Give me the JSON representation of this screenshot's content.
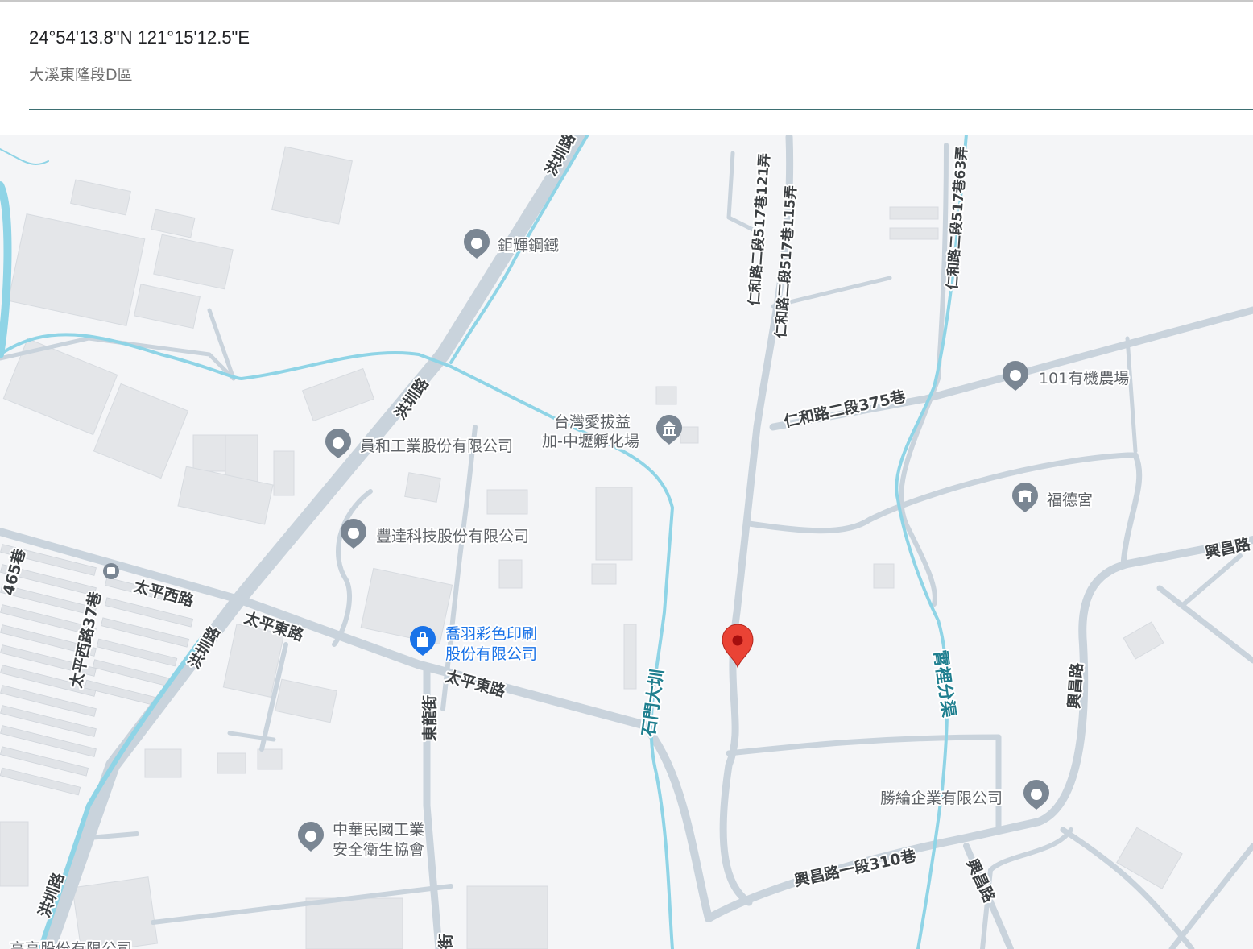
{
  "location": {
    "coordinates": "24°54'13.8\"N 121°15'12.5\"E",
    "name_value": "大溪東隆段D區"
  },
  "colors": {
    "map_bg": "#f4f5f7",
    "road": "#c9d3dc",
    "water": "#8fd4e6",
    "building": "#e4e6e9",
    "poi_gray": "#7a8693",
    "poi_blue": "#1a73e8",
    "pin_red": "#ea4335",
    "road_label": "#3c4043",
    "water_label": "#1f7f8f"
  },
  "map": {
    "pois": [
      {
        "name": "鉅輝鋼鐵",
        "kind": "pin",
        "icon": "pin-icon"
      },
      {
        "name": "員和工業股份有限公司",
        "kind": "pin",
        "icon": "pin-icon"
      },
      {
        "name": "豐達科技股份有限公司",
        "kind": "pin",
        "icon": "pin-icon"
      },
      {
        "name": "台灣愛拔益",
        "name2": "加-中壢孵化場",
        "kind": "government",
        "icon": "building-icon"
      },
      {
        "name": "101有機農場",
        "kind": "pin",
        "icon": "pin-icon"
      },
      {
        "name": "福德宮",
        "kind": "temple",
        "icon": "temple-icon"
      },
      {
        "name": "喬羽彩色印刷",
        "name2": "股份有限公司",
        "kind": "shopping",
        "icon": "shopping-bag-icon"
      },
      {
        "name": "勝綸企業有限公司",
        "kind": "pin",
        "icon": "pin-icon"
      },
      {
        "name": "中華民國工業",
        "name2": "安全衛生協會",
        "kind": "pin",
        "icon": "pin-icon"
      },
      {
        "name": "高亨股份有限公司",
        "kind": "pin",
        "icon": "pin-icon"
      }
    ],
    "road_labels": {
      "hongzhen_1": "洪圳路",
      "hongzhen_2": "洪圳路",
      "hongzhen_3": "洪圳路",
      "hongzhen_4": "洪圳路",
      "taiping_w": "太平西路",
      "taiping_e1": "太平東路",
      "taiping_e2": "太平東路",
      "taiping_w37": "太平西路37巷",
      "lane_65": "465巷",
      "donglong": "東龍街",
      "street_partial": "街",
      "renhe_121": "仁和路二段517巷121弄",
      "renhe_115": "仁和路二段517巷115弄",
      "renhe_63": "仁和路二段517巷63弄",
      "renhe_375": "仁和路二段375巷",
      "xingchang_1": "興昌路",
      "xingchang_2": "興昌路",
      "xingchang_3": "興昌路",
      "xingchang_310": "興昌路一段310巷"
    },
    "water_labels": {
      "shimen": "石門大圳",
      "xiaoli": "霄裡分渠"
    }
  }
}
